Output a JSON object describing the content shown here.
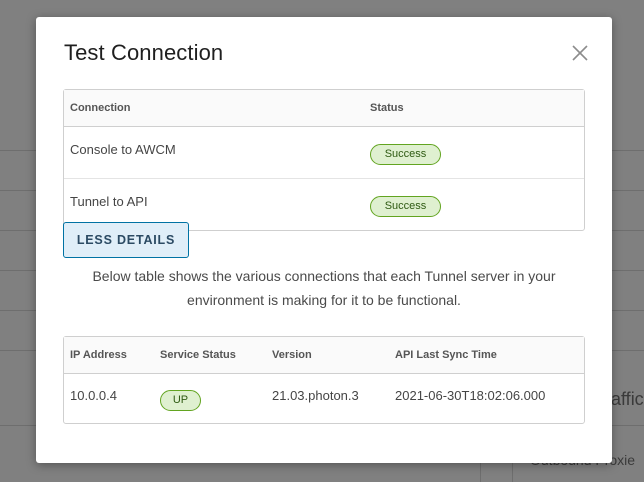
{
  "background": {
    "partial_text_1": "affic",
    "partial_text_2": "Outbound Proxie"
  },
  "modal": {
    "title": "Test Connection",
    "close_icon": "close-icon"
  },
  "connections_table": {
    "headers": [
      "Connection",
      "Status"
    ],
    "rows": [
      {
        "connection": "Console to AWCM",
        "status": "Success"
      },
      {
        "connection": "Tunnel to API",
        "status": "Success"
      }
    ]
  },
  "details_button": {
    "label": "LESS DETAILS"
  },
  "description": "Below table shows the various connections that each Tunnel server in your environment is making for it to be functional.",
  "servers_table": {
    "headers": [
      "IP Address",
      "Service Status",
      "Version",
      "API Last Sync Time"
    ],
    "rows": [
      {
        "ip": "10.0.0.4",
        "service_status": "UP",
        "version": "21.03.photon.3",
        "last_sync": "2021-06-30T18:02:06.000"
      }
    ]
  },
  "colors": {
    "accent": "#0072a3",
    "success_border": "#62a420",
    "success_bg": "#dff0d0",
    "backdrop": "#808080"
  }
}
